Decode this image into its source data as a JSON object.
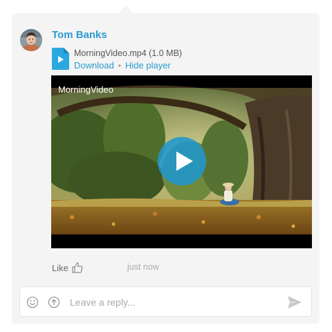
{
  "post": {
    "author": "Tom Banks",
    "avatar_icon": "user-avatar",
    "timestamp": "just now",
    "like_label": "Like"
  },
  "attachment": {
    "icon": "video-file-icon",
    "file_name": "MorningVideo.mp4 (1.0 MB)",
    "download_label": "Download",
    "separator": "•",
    "hide_player_label": "Hide player"
  },
  "player": {
    "video_title": "MorningVideo",
    "play_icon": "play-icon"
  },
  "reply": {
    "placeholder": "Leave a reply...",
    "value": "",
    "emoji_icon": "smiley-icon",
    "upload_icon": "upload-icon",
    "send_icon": "send-icon"
  },
  "colors": {
    "link": "#2a9bd1",
    "card_bg": "#f4f4f4",
    "play_button": "#2196cd"
  }
}
